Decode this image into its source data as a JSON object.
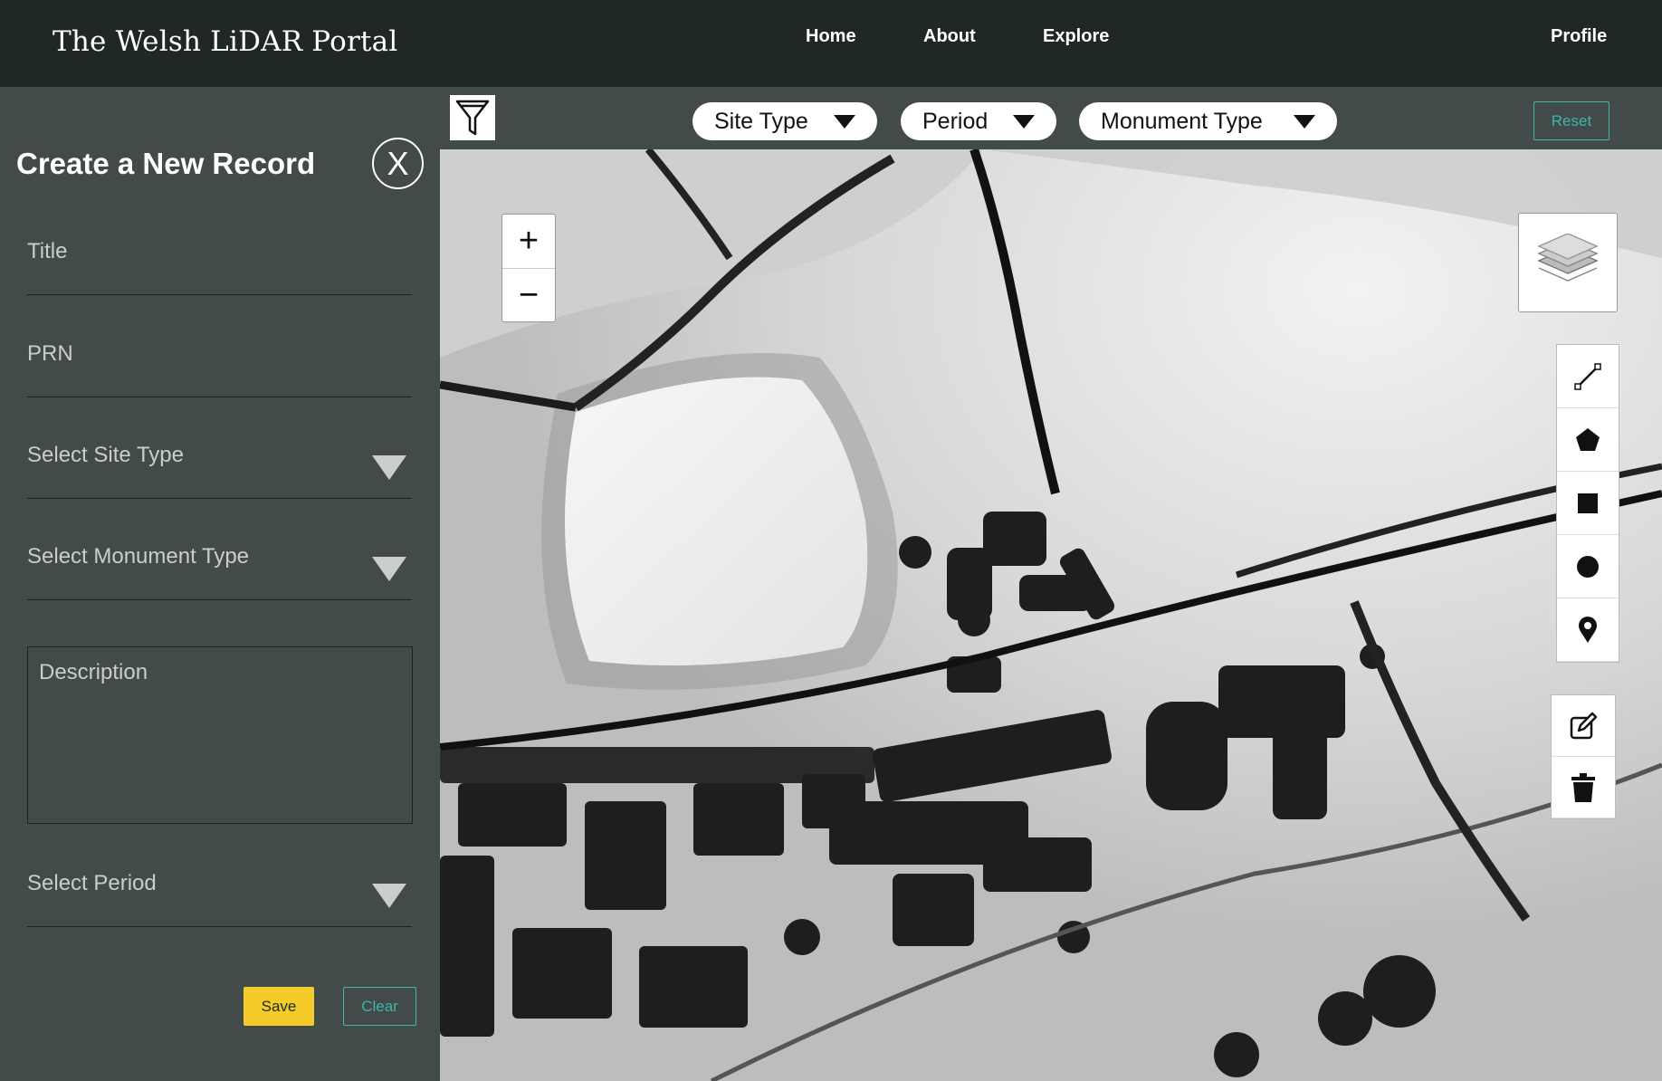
{
  "header": {
    "brand": "The Welsh LiDAR Portal",
    "nav": [
      {
        "label": "Home"
      },
      {
        "label": "About"
      },
      {
        "label": "Explore"
      }
    ],
    "profile_label": "Profile"
  },
  "sidebar": {
    "title": "Create a New Record",
    "close_label": "X",
    "fields": {
      "title_placeholder": "Title",
      "prn_placeholder": "PRN",
      "site_type_placeholder": "Select Site Type",
      "monument_type_placeholder": "Select Monument Type",
      "description_placeholder": "Description",
      "period_placeholder": "Select Period"
    },
    "save_label": "Save",
    "clear_label": "Clear"
  },
  "filters": {
    "icon": "filter-icon",
    "site_type_label": "Site Type",
    "period_label": "Period",
    "monument_type_label": "Monument Type",
    "reset_label": "Reset"
  },
  "map": {
    "zoom_in_label": "+",
    "zoom_out_label": "−",
    "layers_icon": "layers-icon",
    "draw_tools": [
      "polyline-icon",
      "polygon-icon",
      "rectangle-icon",
      "circle-icon",
      "marker-icon"
    ],
    "edit_tools": [
      "edit-icon",
      "trash-icon"
    ]
  },
  "colors": {
    "header_bg": "#1f2827",
    "sidebar_bg": "#434b4a",
    "accent_teal": "#3fb5a6",
    "save_yellow": "#f3cc2a"
  }
}
